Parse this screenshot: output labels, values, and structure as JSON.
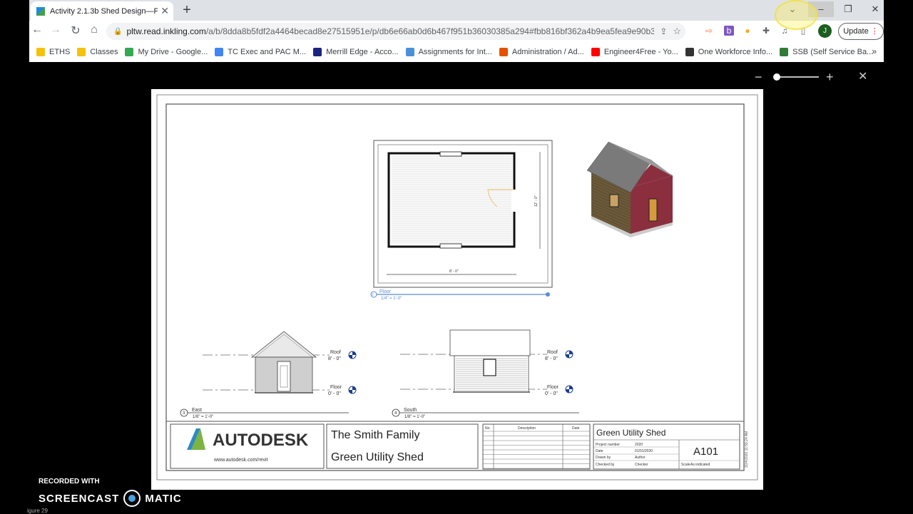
{
  "browser": {
    "tab_title": "Activity 2.1.3b Shed Design—Pa",
    "url_host": "pltw.read.inkling.com",
    "url_path": "/a/b/8dda8b5fdf2a4464becad8e27515951e/p/db6e66ab0d6b467f951b36030385a294#fbb816bf362a4b9ea5fea9e90b3…",
    "update_label": "Update",
    "profile_initial": "J",
    "bookmarks": [
      {
        "label": "ETHS",
        "color": "#f4c20d"
      },
      {
        "label": "Classes",
        "color": "#f4c20d"
      },
      {
        "label": "My Drive - Google...",
        "color": "#34a853"
      },
      {
        "label": "TC Exec and PAC M...",
        "color": "#4285f4"
      },
      {
        "label": "Merrill Edge - Acco...",
        "color": "#1a237e"
      },
      {
        "label": "Assignments for Int...",
        "color": "#4a90d9"
      },
      {
        "label": "Administration / Ad...",
        "color": "#e65100"
      },
      {
        "label": "Engineer4Free - Yo...",
        "color": "#ff0000"
      },
      {
        "label": "One Workforce Info...",
        "color": "#333333"
      },
      {
        "label": "SSB (Self Service Ba...",
        "color": "#2e7d32"
      }
    ]
  },
  "viewer": {
    "zoom_out": "−",
    "zoom_in": "+",
    "close": "✕",
    "zoom_level": 0.05
  },
  "drawing": {
    "floor_plan": {
      "view_number": "2",
      "name": "Floor",
      "scale": "1/4\" = 1'-0\"",
      "dim_width": "8' - 0\"",
      "dim_depth": "12' - 0\""
    },
    "east": {
      "view_number": "3",
      "name": "East",
      "scale": "1/8\" = 1'-0\"",
      "roof_label": "Roof",
      "roof_elev": "8' - 0\"",
      "floor_label": "Floor",
      "floor_elev": "0' - 0\""
    },
    "south": {
      "view_number": "4",
      "name": "South",
      "scale": "1/8\" = 1'-0\"",
      "roof_label": "Roof",
      "roof_elev": "8' - 0\"",
      "floor_label": "Floor",
      "floor_elev": "0' - 0\""
    },
    "title_block": {
      "logo_text": "AUTODESK",
      "logo_url": "www.autodesk.com/revit",
      "client": "The Smith Family",
      "project": "Green Utility Shed",
      "rev_col_no": "No.",
      "rev_col_desc": "Description",
      "rev_col_date": "Date",
      "sheet_title": "Green Utility Shed",
      "project_number_label": "Project number",
      "project_number": "2020",
      "date_label": "Date",
      "date": "01/01/2020",
      "drawn_by_label": "Drawn by",
      "drawn_by": "Author",
      "checked_by_label": "Checked by",
      "checked_by": "Checker",
      "sheet_number": "A101",
      "scale_label": "Scale",
      "scale": "As indicated",
      "timestamp": "3/24/2020 11:59:24 AM"
    }
  },
  "watermark": {
    "recorded_with": "RECORDED WITH",
    "brand_left": "SCREENCAST",
    "brand_right": "MATIC",
    "figure_label": "igure 29"
  }
}
